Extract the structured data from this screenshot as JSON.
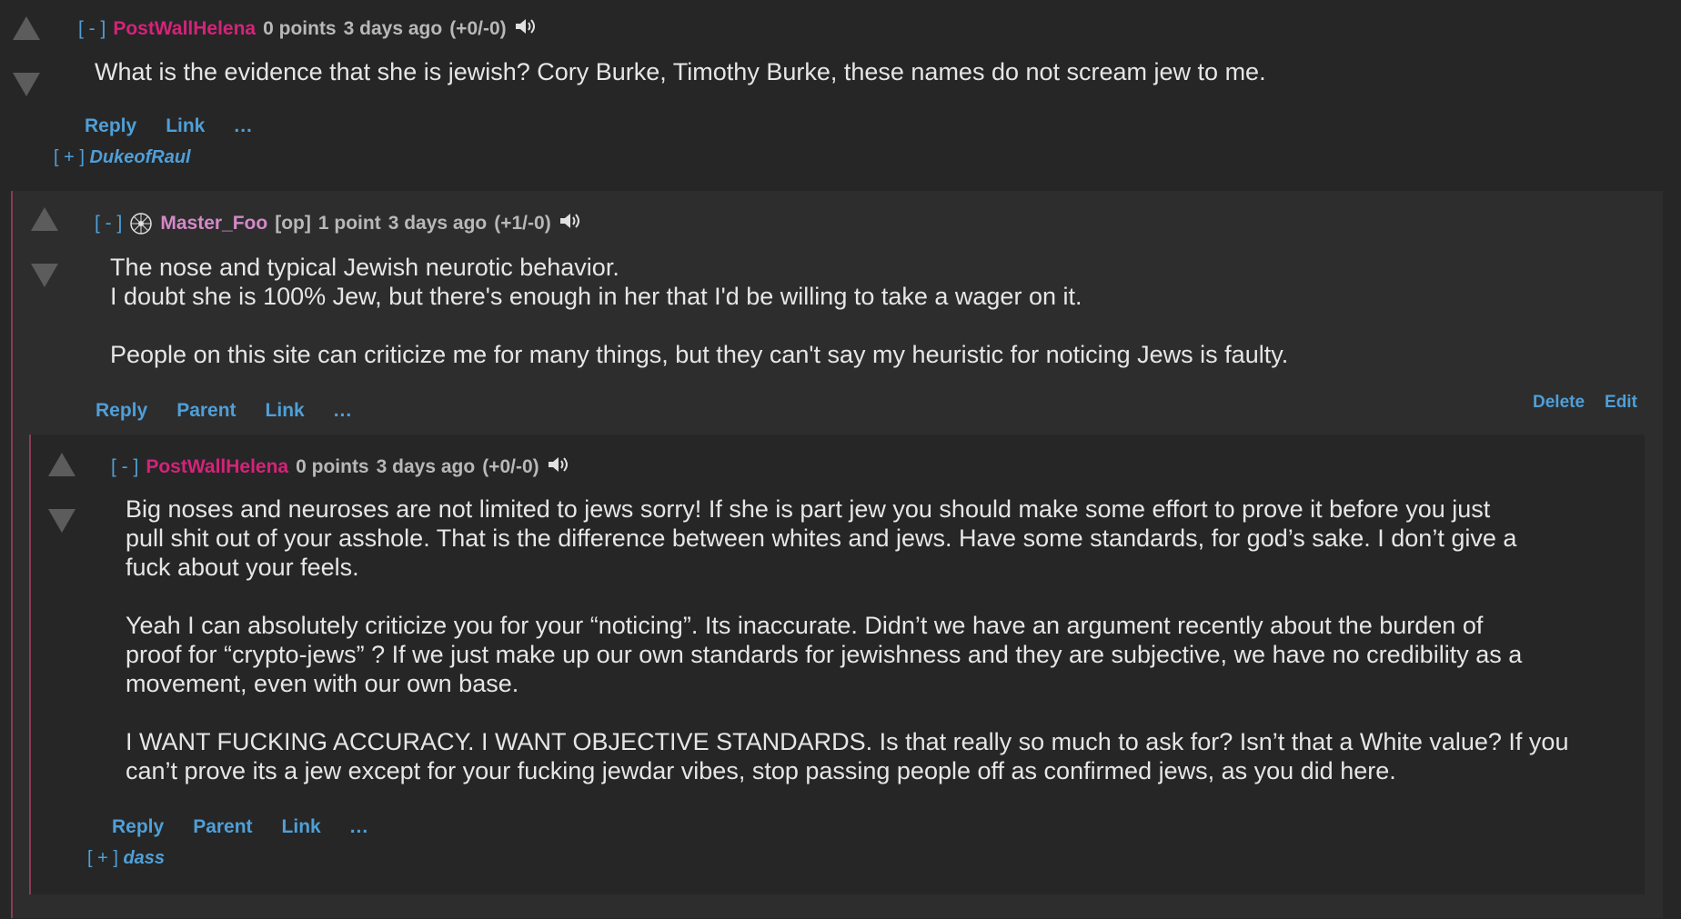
{
  "comment1": {
    "toggle": "[ - ]",
    "author": "PostWallHelena",
    "points": "0 points",
    "time": "3 days ago",
    "votes": "(+0/-0)",
    "body": [
      "What is the evidence that she is jewish? Cory Burke, Timothy Burke, these names do not scream jew to me."
    ],
    "actions": {
      "reply": "Reply",
      "link": "Link",
      "more": "..."
    },
    "collapsed_child": {
      "toggle": "[ + ]",
      "author": "DukeofRaul"
    }
  },
  "comment2": {
    "toggle": "[ - ]",
    "author": "Master_Foo",
    "op_tag": "[op]",
    "points": "1 point",
    "time": "3 days ago",
    "votes": "(+1/-0)",
    "body": [
      "The nose and typical Jewish neurotic behavior.",
      "I doubt she is 100% Jew, but there's enough in her that I'd be willing to take a wager on it.",
      "",
      "People on this site can criticize me for many things, but they can't say my heuristic for noticing Jews is faulty."
    ],
    "actions": {
      "reply": "Reply",
      "parent": "Parent",
      "link": "Link",
      "more": "..."
    },
    "owner_actions": {
      "delete": "Delete",
      "edit": "Edit"
    }
  },
  "comment3": {
    "toggle": "[ - ]",
    "author": "PostWallHelena",
    "points": "0 points",
    "time": "3 days ago",
    "votes": "(+0/-0)",
    "body": [
      "Big noses and neuroses are not limited to jews sorry! If she is part jew you should make some effort to prove it before you just",
      "pull shit out of your asshole. That is the difference between whites and jews. Have some standards, for god’s sake. I don’t give a",
      "fuck about your feels.",
      "",
      "Yeah I can absolutely criticize you for your “noticing”. Its inaccurate. Didn’t we have an argument recently about the burden of",
      "proof for “crypto-jews” ? If we just make up our own standards for jewishness and they are subjective, we have no credibility as a",
      "movement, even with our own base.",
      "",
      "I WANT FUCKING ACCURACY. I WANT OBJECTIVE STANDARDS. Is that really so much to ask for? Isn’t that a White value? If you",
      "can’t prove its a jew except for your fucking jewdar vibes, stop passing people off as confirmed jews, as you did here."
    ],
    "actions": {
      "reply": "Reply",
      "parent": "Parent",
      "link": "Link",
      "more": "..."
    },
    "collapsed_child": {
      "toggle": "[ + ]",
      "author": "dass"
    }
  },
  "colors": {
    "accent": "#4f9fd8",
    "author": "#d4237a",
    "op_author": "#d489c8",
    "thread_line": "#8a3a5a"
  }
}
